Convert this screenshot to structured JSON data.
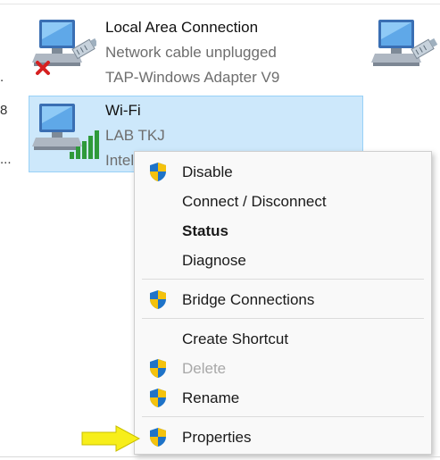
{
  "left_edge": {
    "row1": ".",
    "row2": "8",
    "row3": "..."
  },
  "connections": [
    {
      "name": "Local Area Connection",
      "status": "Network cable unplugged",
      "adapter": "TAP-Windows Adapter V9",
      "state": "disconnected",
      "icon": "network-disconnected-icon"
    },
    {
      "name": "Wi-Fi",
      "status": "LAB TKJ",
      "adapter": "Intel",
      "state": "connected-selected",
      "icon": "wifi-network-icon"
    },
    {
      "icon": "network-adapter-icon"
    }
  ],
  "context_menu": {
    "items": [
      {
        "label": "Disable",
        "icon": "uac-shield-icon",
        "enabled": true,
        "bold": false
      },
      {
        "label": "Connect / Disconnect",
        "icon": null,
        "enabled": true,
        "bold": false
      },
      {
        "label": "Status",
        "icon": null,
        "enabled": true,
        "bold": true
      },
      {
        "label": "Diagnose",
        "icon": null,
        "enabled": true,
        "bold": false
      },
      {
        "label": "Bridge Connections",
        "icon": "uac-shield-icon",
        "enabled": true,
        "bold": false
      },
      {
        "label": "Create Shortcut",
        "icon": null,
        "enabled": true,
        "bold": false
      },
      {
        "label": "Delete",
        "icon": "uac-shield-icon",
        "enabled": false,
        "bold": false
      },
      {
        "label": "Rename",
        "icon": "uac-shield-icon",
        "enabled": true,
        "bold": false
      },
      {
        "label": "Properties",
        "icon": "uac-shield-icon",
        "enabled": true,
        "bold": false
      }
    ]
  },
  "annotation": {
    "icon": "yellow-arrow-icon",
    "color": "#f7ee1a"
  },
  "colors": {
    "selection": "#cde8fb",
    "selection_border": "#99d1f7",
    "shield_blue": "#1e73c8",
    "shield_yellow": "#f4c20d"
  }
}
